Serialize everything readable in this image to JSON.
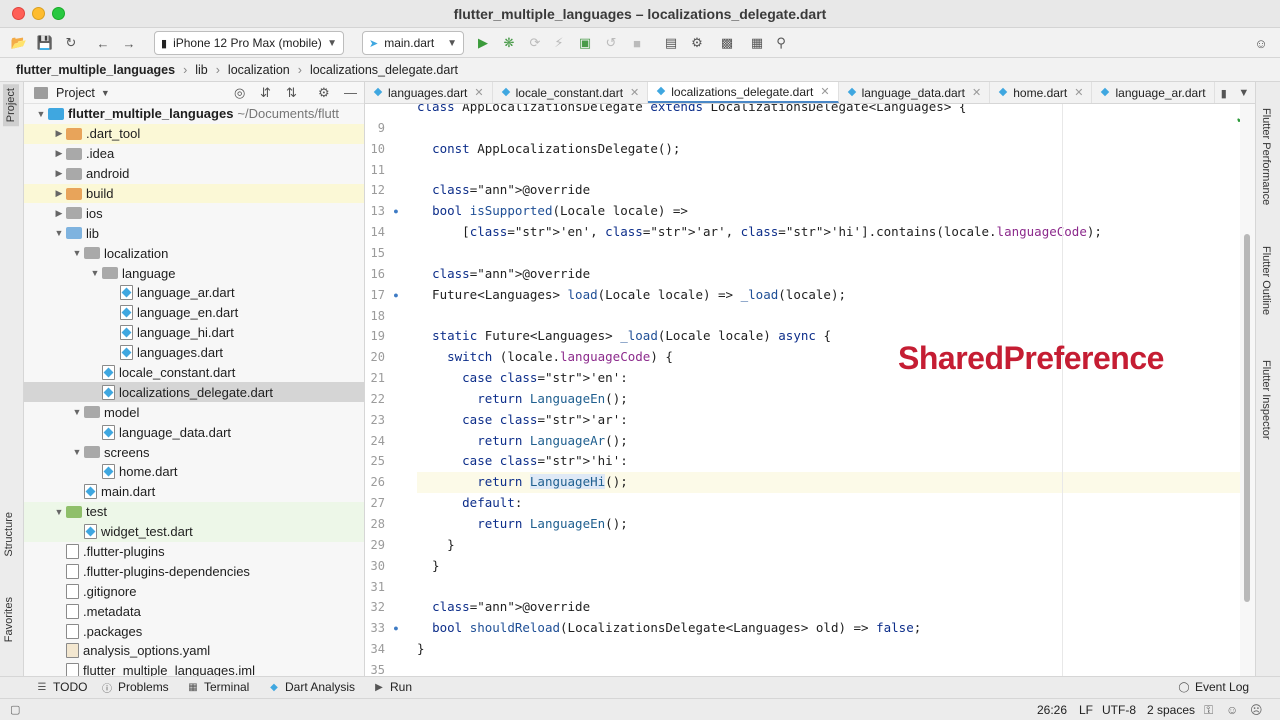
{
  "window": {
    "title": "flutter_multiple_languages – localizations_delegate.dart"
  },
  "toolbar": {
    "device_combo": "iPhone 12 Pro Max (mobile)",
    "run_config_combo": "main.dart"
  },
  "breadcrumb": [
    "flutter_multiple_languages",
    "lib",
    "localization",
    "localizations_delegate.dart"
  ],
  "left_strip": {
    "project_tab": "Project",
    "structure_tab": "Structure",
    "favorites_tab": "Favorites"
  },
  "project_panel": {
    "header": "Project",
    "tree": [
      {
        "label": "flutter_multiple_languages",
        "path": "~/Documents/flutt",
        "level": 0,
        "kind": "root"
      },
      {
        "label": ".dart_tool",
        "level": 1,
        "kind": "folder-orange"
      },
      {
        "label": ".idea",
        "level": 1,
        "kind": "folder-grey"
      },
      {
        "label": "android",
        "level": 1,
        "kind": "folder-grey"
      },
      {
        "label": "build",
        "level": 1,
        "kind": "folder-orange"
      },
      {
        "label": "ios",
        "level": 1,
        "kind": "folder-grey"
      },
      {
        "label": "lib",
        "level": 1,
        "kind": "folder-blue"
      },
      {
        "label": "localization",
        "level": 2,
        "kind": "folder-grey"
      },
      {
        "label": "language",
        "level": 3,
        "kind": "folder-grey"
      },
      {
        "label": "language_ar.dart",
        "level": 4,
        "kind": "dart"
      },
      {
        "label": "language_en.dart",
        "level": 4,
        "kind": "dart"
      },
      {
        "label": "language_hi.dart",
        "level": 4,
        "kind": "dart"
      },
      {
        "label": "languages.dart",
        "level": 4,
        "kind": "dart"
      },
      {
        "label": "locale_constant.dart",
        "level": 3,
        "kind": "dart"
      },
      {
        "label": "localizations_delegate.dart",
        "level": 3,
        "kind": "dart"
      },
      {
        "label": "model",
        "level": 2,
        "kind": "folder-grey"
      },
      {
        "label": "language_data.dart",
        "level": 3,
        "kind": "dart"
      },
      {
        "label": "screens",
        "level": 2,
        "kind": "folder-grey"
      },
      {
        "label": "home.dart",
        "level": 3,
        "kind": "dart"
      },
      {
        "label": "main.dart",
        "level": 2,
        "kind": "dart"
      },
      {
        "label": "test",
        "level": 1,
        "kind": "folder-green"
      },
      {
        "label": "widget_test.dart",
        "level": 2,
        "kind": "dart"
      },
      {
        "label": ".flutter-plugins",
        "level": 1,
        "kind": "file"
      },
      {
        "label": ".flutter-plugins-dependencies",
        "level": 1,
        "kind": "file"
      },
      {
        "label": ".gitignore",
        "level": 1,
        "kind": "file"
      },
      {
        "label": ".metadata",
        "level": 1,
        "kind": "file"
      },
      {
        "label": ".packages",
        "level": 1,
        "kind": "file"
      },
      {
        "label": "analysis_options.yaml",
        "level": 1,
        "kind": "yaml"
      },
      {
        "label": "flutter_multiple_languages.iml",
        "level": 1,
        "kind": "file"
      }
    ]
  },
  "tabs": [
    {
      "label": "languages.dart",
      "active": false
    },
    {
      "label": "locale_constant.dart",
      "active": false
    },
    {
      "label": "localizations_delegate.dart",
      "active": true
    },
    {
      "label": "language_data.dart",
      "active": false
    },
    {
      "label": "home.dart",
      "active": false
    },
    {
      "label": "language_ar.dart",
      "active": false
    }
  ],
  "editor": {
    "lines": [
      {
        "n": "",
        "text": "class AppLocalizationsDelegate extends LocalizationsDelegate<Languages> {"
      },
      {
        "n": "9",
        "text": ""
      },
      {
        "n": "10",
        "text": "  const AppLocalizationsDelegate();"
      },
      {
        "n": "11",
        "text": ""
      },
      {
        "n": "12",
        "text": "  @override"
      },
      {
        "n": "13",
        "text": "  bool isSupported(Locale locale) =>"
      },
      {
        "n": "14",
        "text": "      ['en', 'ar', 'hi'].contains(locale.languageCode);"
      },
      {
        "n": "15",
        "text": ""
      },
      {
        "n": "16",
        "text": "  @override"
      },
      {
        "n": "17",
        "text": "  Future<Languages> load(Locale locale) => _load(locale);"
      },
      {
        "n": "18",
        "text": ""
      },
      {
        "n": "19",
        "text": "  static Future<Languages> _load(Locale locale) async {"
      },
      {
        "n": "20",
        "text": "    switch (locale.languageCode) {"
      },
      {
        "n": "21",
        "text": "      case 'en':"
      },
      {
        "n": "22",
        "text": "        return LanguageEn();"
      },
      {
        "n": "23",
        "text": "      case 'ar':"
      },
      {
        "n": "24",
        "text": "        return LanguageAr();"
      },
      {
        "n": "25",
        "text": "      case 'hi':"
      },
      {
        "n": "26",
        "text": "        return LanguageHi();"
      },
      {
        "n": "27",
        "text": "      default:"
      },
      {
        "n": "28",
        "text": "        return LanguageEn();"
      },
      {
        "n": "29",
        "text": "    }"
      },
      {
        "n": "30",
        "text": "  }"
      },
      {
        "n": "31",
        "text": ""
      },
      {
        "n": "32",
        "text": "  @override"
      },
      {
        "n": "33",
        "text": "  bool shouldReload(LocalizationsDelegate<Languages> old) => false;"
      },
      {
        "n": "34",
        "text": "}"
      },
      {
        "n": "35",
        "text": ""
      }
    ],
    "overlay_caption": "SharedPreference"
  },
  "right_strip": {
    "flutter_performance": "Flutter Performance",
    "flutter_outline": "Flutter Outline",
    "flutter_inspector": "Flutter Inspector"
  },
  "bottom_bar": {
    "todo": "TODO",
    "problems": "Problems",
    "terminal": "Terminal",
    "dart_analysis": "Dart Analysis",
    "run": "Run",
    "event_log": "Event Log"
  },
  "status_bar": {
    "position": "26:26",
    "line_sep": "LF",
    "encoding": "UTF-8",
    "indent": "2 spaces"
  }
}
